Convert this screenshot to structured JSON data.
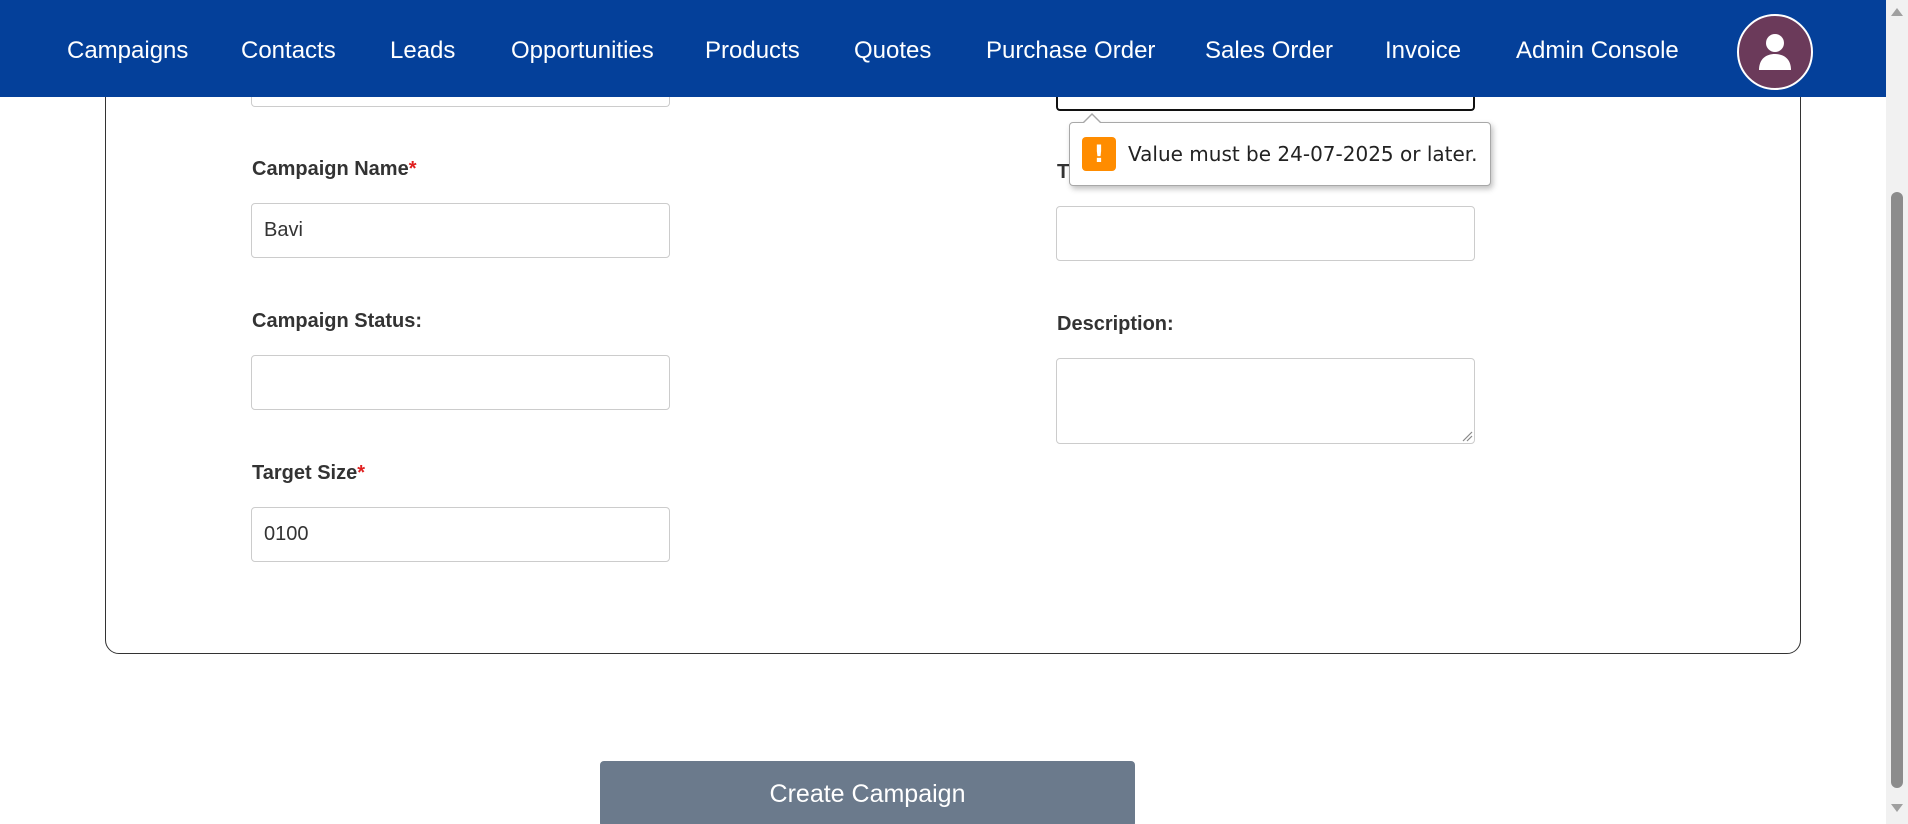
{
  "nav": {
    "items": [
      {
        "label": "Campaigns"
      },
      {
        "label": "Contacts"
      },
      {
        "label": "Leads"
      },
      {
        "label": "Opportunities"
      },
      {
        "label": "Products"
      },
      {
        "label": "Quotes"
      },
      {
        "label": "Purchase Order"
      },
      {
        "label": "Sales Order"
      },
      {
        "label": "Invoice"
      },
      {
        "label": "Admin Console"
      }
    ],
    "avatar_icon": "user-icon"
  },
  "form": {
    "campaign_name": {
      "label": "Campaign Name",
      "required_mark": "*",
      "value": "Bavi"
    },
    "campaign_status": {
      "label": "Campaign Status:",
      "value": ""
    },
    "target_size": {
      "label": "Target Size",
      "required_mark": "*",
      "value": "0100"
    },
    "right_field": {
      "label_partial": "T",
      "value": ""
    },
    "description": {
      "label": "Description:",
      "value": ""
    }
  },
  "tooltip": {
    "icon": "warning-icon",
    "icon_glyph": "!",
    "message": "Value must be 24-07-2025 or later."
  },
  "submit": {
    "label": "Create Campaign"
  },
  "colors": {
    "navbar": "#04409a",
    "avatar": "#6b3a5a",
    "button": "#6b7a8c",
    "required": "#e02020",
    "warning": "#ff8c00"
  }
}
